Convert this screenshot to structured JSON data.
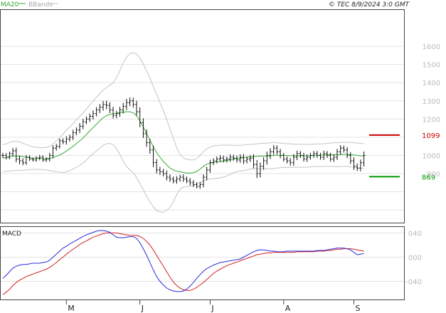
{
  "chart_data": [
    {
      "type": "ohlc",
      "title": "",
      "legend": [
        {
          "name": "MA20",
          "color": "#33aa33"
        },
        {
          "name": "BBands",
          "color": "#bbbbbb"
        }
      ],
      "copyright": "© TEC 8/9/2024 3:0 GMT",
      "x_labels": [
        "M",
        "J",
        "J",
        "A",
        "S"
      ],
      "x_label_index": [
        19,
        41,
        62,
        84,
        105
      ],
      "ylim": [
        630,
        1800
      ],
      "yticks": [
        700,
        800,
        900,
        1000,
        1100,
        1200,
        1300,
        1400,
        1500,
        1600
      ],
      "ytick_labels": [
        "",
        "",
        "900",
        "1000",
        "",
        "1200",
        "1300",
        "1400",
        "1500",
        "1600"
      ],
      "grid": true,
      "levels": [
        {
          "label": "1099",
          "value": 1112,
          "color": "#cc0000",
          "line_from": 519
        },
        {
          "label": "869",
          "value": 883,
          "color": "#009900",
          "line_from": 519
        }
      ],
      "closes": [
        1000,
        990,
        1010,
        1025,
        980,
        970,
        960,
        990,
        980,
        975,
        985,
        990,
        975,
        980,
        1000,
        1040,
        1050,
        1080,
        1075,
        1090,
        1100,
        1125,
        1140,
        1160,
        1185,
        1200,
        1215,
        1230,
        1250,
        1265,
        1280,
        1275,
        1250,
        1220,
        1230,
        1250,
        1270,
        1290,
        1300,
        1280,
        1240,
        1180,
        1120,
        1070,
        1030,
        960,
        920,
        910,
        900,
        880,
        870,
        860,
        870,
        880,
        870,
        860,
        850,
        840,
        830,
        840,
        880,
        920,
        960,
        970,
        980,
        985,
        975,
        980,
        990,
        985,
        975,
        990,
        970,
        980,
        985,
        950,
        900,
        940,
        970,
        1000,
        1020,
        1040,
        1020,
        1000,
        980,
        970,
        960,
        990,
        1010,
        1000,
        980,
        990,
        1000,
        1010,
        1000,
        990,
        1010,
        1000,
        980,
        990,
        1020,
        1040,
        1030,
        1000,
        970,
        940,
        930,
        960,
        1000
      ],
      "ranges": [
        40,
        35,
        30,
        45,
        50,
        55,
        40,
        35,
        30,
        25,
        30,
        35,
        30,
        30,
        40,
        45,
        40,
        35,
        40,
        45,
        40,
        45,
        40,
        50,
        45,
        40,
        45,
        50,
        45,
        50,
        55,
        60,
        50,
        50,
        45,
        50,
        55,
        60,
        55,
        50,
        60,
        70,
        70,
        65,
        60,
        70,
        55,
        50,
        45,
        50,
        45,
        40,
        45,
        40,
        45,
        40,
        45,
        40,
        35,
        40,
        45,
        50,
        45,
        40,
        40,
        45,
        40,
        40,
        45,
        40,
        40,
        45,
        50,
        40,
        45,
        60,
        70,
        60,
        55,
        60,
        55,
        50,
        45,
        45,
        40,
        40,
        45,
        50,
        45,
        40,
        40,
        45,
        40,
        40,
        40,
        40,
        45,
        40,
        40,
        45,
        45,
        45,
        40,
        45,
        50,
        55,
        45,
        50,
        60
      ],
      "ma20": [
        985,
        988,
        993,
        997,
        997,
        996,
        993,
        990,
        987,
        985,
        984,
        983,
        982,
        982,
        983,
        988,
        995,
        1002,
        1012,
        1024,
        1036,
        1050,
        1065,
        1080,
        1096,
        1115,
        1135,
        1153,
        1172,
        1190,
        1207,
        1219,
        1226,
        1229,
        1232,
        1236,
        1238,
        1240,
        1240,
        1235,
        1218,
        1190,
        1158,
        1120,
        1085,
        1048,
        1016,
        990,
        967,
        948,
        930,
        920,
        913,
        910,
        906,
        903,
        903,
        905,
        912,
        925,
        940,
        952,
        958,
        962,
        964,
        966,
        969,
        972,
        976,
        980,
        983,
        985,
        987,
        990,
        993,
        994,
        995,
        996,
        996,
        997,
        998,
        999,
        1000,
        1000,
        1000,
        999,
        999,
        998,
        998,
        998,
        998,
        998,
        999,
        1000,
        1001,
        1001,
        1002,
        1003,
        1004,
        1004,
        1004,
        1005,
        1006,
        1006,
        1004,
        1002,
        1000,
        998,
        997
      ],
      "bb_width": [
        75,
        75,
        78,
        80,
        80,
        78,
        75,
        70,
        65,
        62,
        60,
        60,
        60,
        62,
        66,
        75,
        85,
        95,
        105,
        115,
        120,
        125,
        130,
        135,
        138,
        140,
        142,
        145,
        148,
        150,
        152,
        155,
        160,
        170,
        195,
        230,
        270,
        300,
        320,
        330,
        340,
        345,
        345,
        345,
        340,
        330,
        320,
        300,
        280,
        250,
        215,
        175,
        130,
        95,
        80,
        75,
        72,
        70,
        70,
        75,
        80,
        85,
        88,
        90,
        90,
        90,
        88,
        85,
        80,
        75,
        72,
        70,
        70,
        70,
        68,
        68,
        68,
        70,
        70,
        70,
        72,
        72,
        70,
        68,
        66,
        65,
        65,
        64,
        64,
        63,
        63,
        63,
        62,
        62,
        62,
        62,
        62,
        63,
        64,
        65,
        66,
        66,
        66,
        66,
        67,
        68,
        68,
        68,
        68
      ],
      "macd_panel": {
        "title": "MACD",
        "ylim": [
          -70,
          50
        ],
        "yticks": [
          -40,
          0,
          40
        ],
        "ytick_labels": [
          "-040",
          "000",
          "040"
        ],
        "macd_color": "#2a2ae0",
        "signal_color": "#d42020",
        "macd": [
          -35,
          -30,
          -24,
          -18,
          -15,
          -13,
          -12,
          -12,
          -11,
          -10,
          -10,
          -10,
          -9,
          -8,
          -5,
          0,
          5,
          10,
          15,
          18,
          22,
          25,
          28,
          31,
          34,
          37,
          39,
          41,
          43,
          44,
          44,
          43,
          41,
          37,
          33,
          32,
          32,
          33,
          34,
          34,
          31,
          24,
          14,
          3,
          -9,
          -21,
          -32,
          -40,
          -46,
          -51,
          -54,
          -56,
          -57,
          -57,
          -56,
          -53,
          -48,
          -42,
          -35,
          -29,
          -23,
          -19,
          -16,
          -13,
          -11,
          -9,
          -8,
          -7,
          -6,
          -5,
          -4,
          -3,
          0,
          3,
          6,
          9,
          11,
          12,
          12,
          11,
          10,
          10,
          9,
          9,
          9,
          10,
          10,
          10,
          10,
          10,
          10,
          10,
          10,
          10,
          11,
          11,
          11,
          12,
          13,
          14,
          15,
          15,
          15,
          14,
          12,
          8,
          4,
          5,
          6
        ],
        "signal": [
          -62,
          -58,
          -53,
          -47,
          -42,
          -38,
          -35,
          -32,
          -30,
          -28,
          -26,
          -24,
          -22,
          -20,
          -17,
          -13,
          -9,
          -4,
          0,
          5,
          9,
          13,
          17,
          21,
          24,
          27,
          30,
          33,
          35,
          37,
          39,
          40,
          40,
          40,
          40,
          39,
          38,
          37,
          36,
          36,
          36,
          34,
          31,
          26,
          20,
          12,
          3,
          -6,
          -15,
          -24,
          -33,
          -41,
          -47,
          -51,
          -54,
          -55,
          -55,
          -53,
          -50,
          -46,
          -42,
          -37,
          -32,
          -27,
          -23,
          -20,
          -17,
          -14,
          -12,
          -10,
          -8,
          -6,
          -4,
          -2,
          0,
          2,
          4,
          5,
          6,
          7,
          7,
          8,
          8,
          8,
          8,
          8,
          8,
          8,
          9,
          9,
          9,
          9,
          9,
          9,
          10,
          10,
          10,
          11,
          11,
          12,
          13,
          13,
          14,
          14,
          14,
          13,
          12,
          11,
          10
        ]
      }
    }
  ]
}
